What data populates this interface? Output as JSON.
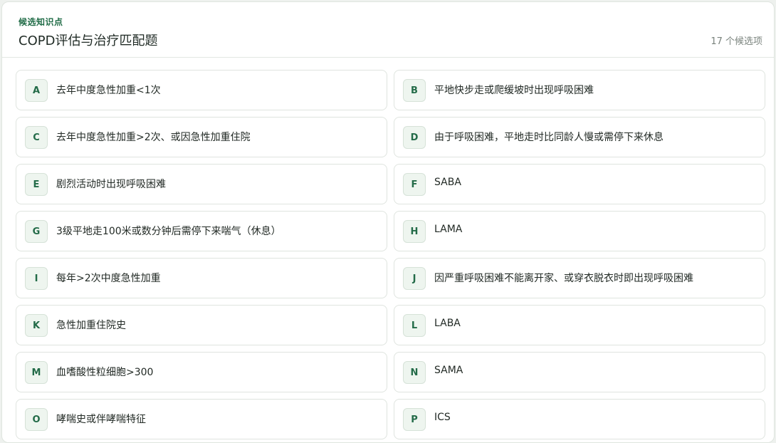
{
  "header": {
    "eyebrow": "候选知识点",
    "title": "COPD评估与治疗匹配题",
    "count": "17 个候选项"
  },
  "options": [
    {
      "letter": "A",
      "text": "去年中度急性加重<1次"
    },
    {
      "letter": "B",
      "text": "平地快步走或爬缓坡时出现呼吸困难"
    },
    {
      "letter": "C",
      "text": "去年中度急性加重>2次、或因急性加重住院"
    },
    {
      "letter": "D",
      "text": "由于呼吸困难，平地走时比同龄人慢或需停下来休息"
    },
    {
      "letter": "E",
      "text": "剧烈活动时出现呼吸困难"
    },
    {
      "letter": "F",
      "text": "SABA"
    },
    {
      "letter": "G",
      "text": "3级平地走100米或数分钟后需停下来喘气（休息）"
    },
    {
      "letter": "H",
      "text": "LAMA"
    },
    {
      "letter": "I",
      "text": "每年>2次中度急性加重"
    },
    {
      "letter": "J",
      "text": "因严重呼吸困难不能离开家、或穿衣脱衣时即出现呼吸困难"
    },
    {
      "letter": "K",
      "text": "急性加重住院史"
    },
    {
      "letter": "L",
      "text": "LABA"
    },
    {
      "letter": "M",
      "text": "血嗜酸性粒细胞>300"
    },
    {
      "letter": "N",
      "text": "SAMA"
    },
    {
      "letter": "O",
      "text": "哮喘史或伴哮喘特征"
    },
    {
      "letter": "P",
      "text": "ICS"
    }
  ]
}
